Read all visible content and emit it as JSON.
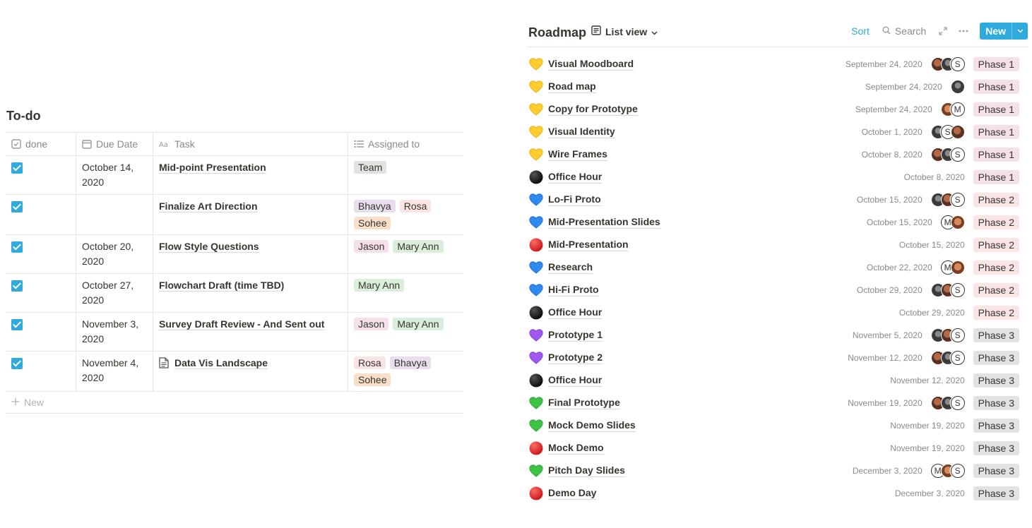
{
  "colors": {
    "accent": "#2eaadc",
    "tag_team": "#e3e2e0",
    "tag_bhavya": "#e8deee",
    "tag_rosa": "#fbe4e4",
    "tag_sohee": "#fadec9",
    "tag_jason": "#f5e0e9",
    "tag_maryann": "#dbeddb",
    "phase1": "#f5e0e9",
    "phase2": "#fbe4e4",
    "phase3": "#e3e2e0"
  },
  "todo": {
    "title": "To-do",
    "columns": {
      "done": "done",
      "due": "Due Date",
      "task": "Task",
      "assigned": "Assigned to"
    },
    "rows": [
      {
        "done": true,
        "date_line1": "October 14,",
        "date_line2": "2020",
        "task": "Mid-point Presentation",
        "has_doc_icon": false,
        "assigned": [
          "Team"
        ]
      },
      {
        "done": true,
        "date_line1": "",
        "date_line2": "",
        "task": "Finalize Art Direction",
        "has_doc_icon": false,
        "assigned": [
          "Bhavya",
          "Rosa",
          "Sohee"
        ]
      },
      {
        "done": true,
        "date_line1": "October 20,",
        "date_line2": "2020",
        "task": "Flow Style Questions",
        "has_doc_icon": false,
        "assigned": [
          "Jason",
          "Mary Ann"
        ]
      },
      {
        "done": true,
        "date_line1": "October 27,",
        "date_line2": "2020",
        "task": "Flowchart Draft (time TBD)",
        "has_doc_icon": false,
        "assigned": [
          "Mary Ann"
        ]
      },
      {
        "done": true,
        "date_line1": "November 3,",
        "date_line2": "2020",
        "task": "Survey Draft Review - And Sent out",
        "has_doc_icon": false,
        "assigned": [
          "Jason",
          "Mary Ann"
        ]
      },
      {
        "done": true,
        "date_line1": "November 4,",
        "date_line2": "2020",
        "task": "Data Vis Landscape",
        "has_doc_icon": true,
        "assigned": [
          "Rosa",
          "Bhavya",
          "Sohee"
        ]
      }
    ],
    "new_label": "New"
  },
  "roadmap": {
    "title": "Roadmap",
    "view_label": "List view",
    "sort_label": "Sort",
    "search_label": "Search",
    "new_label": "New",
    "items": [
      {
        "icon": "yellow-heart-icon",
        "name": "Visual Moodboard",
        "date": "September 24, 2020",
        "avatars": [
          "photo1",
          "photo2",
          "S"
        ],
        "phase": "Phase 1"
      },
      {
        "icon": "yellow-heart-icon",
        "name": "Road map",
        "date": "September 24, 2020",
        "avatars": [
          "photo2"
        ],
        "phase": "Phase 1"
      },
      {
        "icon": "yellow-heart-icon",
        "name": "Copy for Prototype",
        "date": "September 24, 2020",
        "avatars": [
          "photo3",
          "M"
        ],
        "phase": "Phase 1"
      },
      {
        "icon": "yellow-heart-icon",
        "name": "Visual Identity",
        "date": "October 1, 2020",
        "avatars": [
          "photo2",
          "S",
          "photo1"
        ],
        "phase": "Phase 1"
      },
      {
        "icon": "yellow-heart-icon",
        "name": "Wire Frames",
        "date": "October 8, 2020",
        "avatars": [
          "photo1",
          "photo2",
          "S"
        ],
        "phase": "Phase 1"
      },
      {
        "icon": "black-circle-icon",
        "name": "Office Hour",
        "date": "October 8, 2020",
        "avatars": [],
        "phase": "Phase 1"
      },
      {
        "icon": "blue-heart-icon",
        "name": "Lo-Fi Proto",
        "date": "October 15, 2020",
        "avatars": [
          "photo2",
          "photo1",
          "S"
        ],
        "phase": "Phase 2"
      },
      {
        "icon": "blue-heart-icon",
        "name": "Mid-Presentation Slides",
        "date": "October 15, 2020",
        "avatars": [
          "M",
          "photo3"
        ],
        "phase": "Phase 2"
      },
      {
        "icon": "red-circle-icon",
        "name": "Mid-Presentation",
        "date": "October 15, 2020",
        "avatars": [],
        "phase": "Phase 2"
      },
      {
        "icon": "blue-heart-icon",
        "name": "Research",
        "date": "October 22, 2020",
        "avatars": [
          "M",
          "photo3"
        ],
        "phase": "Phase 2"
      },
      {
        "icon": "blue-heart-icon",
        "name": "Hi-Fi Proto",
        "date": "October 29, 2020",
        "avatars": [
          "photo2",
          "photo1",
          "S"
        ],
        "phase": "Phase 2"
      },
      {
        "icon": "black-circle-icon",
        "name": "Office Hour",
        "date": "October 29, 2020",
        "avatars": [],
        "phase": "Phase 2"
      },
      {
        "icon": "purple-heart-icon",
        "name": "Prototype 1",
        "date": "November 5, 2020",
        "avatars": [
          "photo2",
          "photo1",
          "S"
        ],
        "phase": "Phase 3"
      },
      {
        "icon": "purple-heart-icon",
        "name": "Prototype 2",
        "date": "November 12, 2020",
        "avatars": [
          "photo1",
          "photo2",
          "S"
        ],
        "phase": "Phase 3"
      },
      {
        "icon": "black-circle-icon",
        "name": "Office Hour",
        "date": "November 12, 2020",
        "avatars": [],
        "phase": "Phase 3"
      },
      {
        "icon": "green-heart-icon",
        "name": "Final Prototype",
        "date": "November 19, 2020",
        "avatars": [
          "photo1",
          "photo2",
          "S"
        ],
        "phase": "Phase 3"
      },
      {
        "icon": "green-heart-icon",
        "name": "Mock Demo Slides",
        "date": "November 19, 2020",
        "avatars": [],
        "phase": "Phase 3"
      },
      {
        "icon": "red-circle-icon",
        "name": "Mock Demo",
        "date": "November 19, 2020",
        "avatars": [],
        "phase": "Phase 3"
      },
      {
        "icon": "green-heart-icon",
        "name": "Pitch Day Slides",
        "date": "December 3, 2020",
        "avatars": [
          "M",
          "photo3",
          "S"
        ],
        "phase": "Phase 3"
      },
      {
        "icon": "red-circle-icon",
        "name": "Demo Day",
        "date": "December 3, 2020",
        "avatars": [],
        "phase": "Phase 3"
      }
    ]
  }
}
